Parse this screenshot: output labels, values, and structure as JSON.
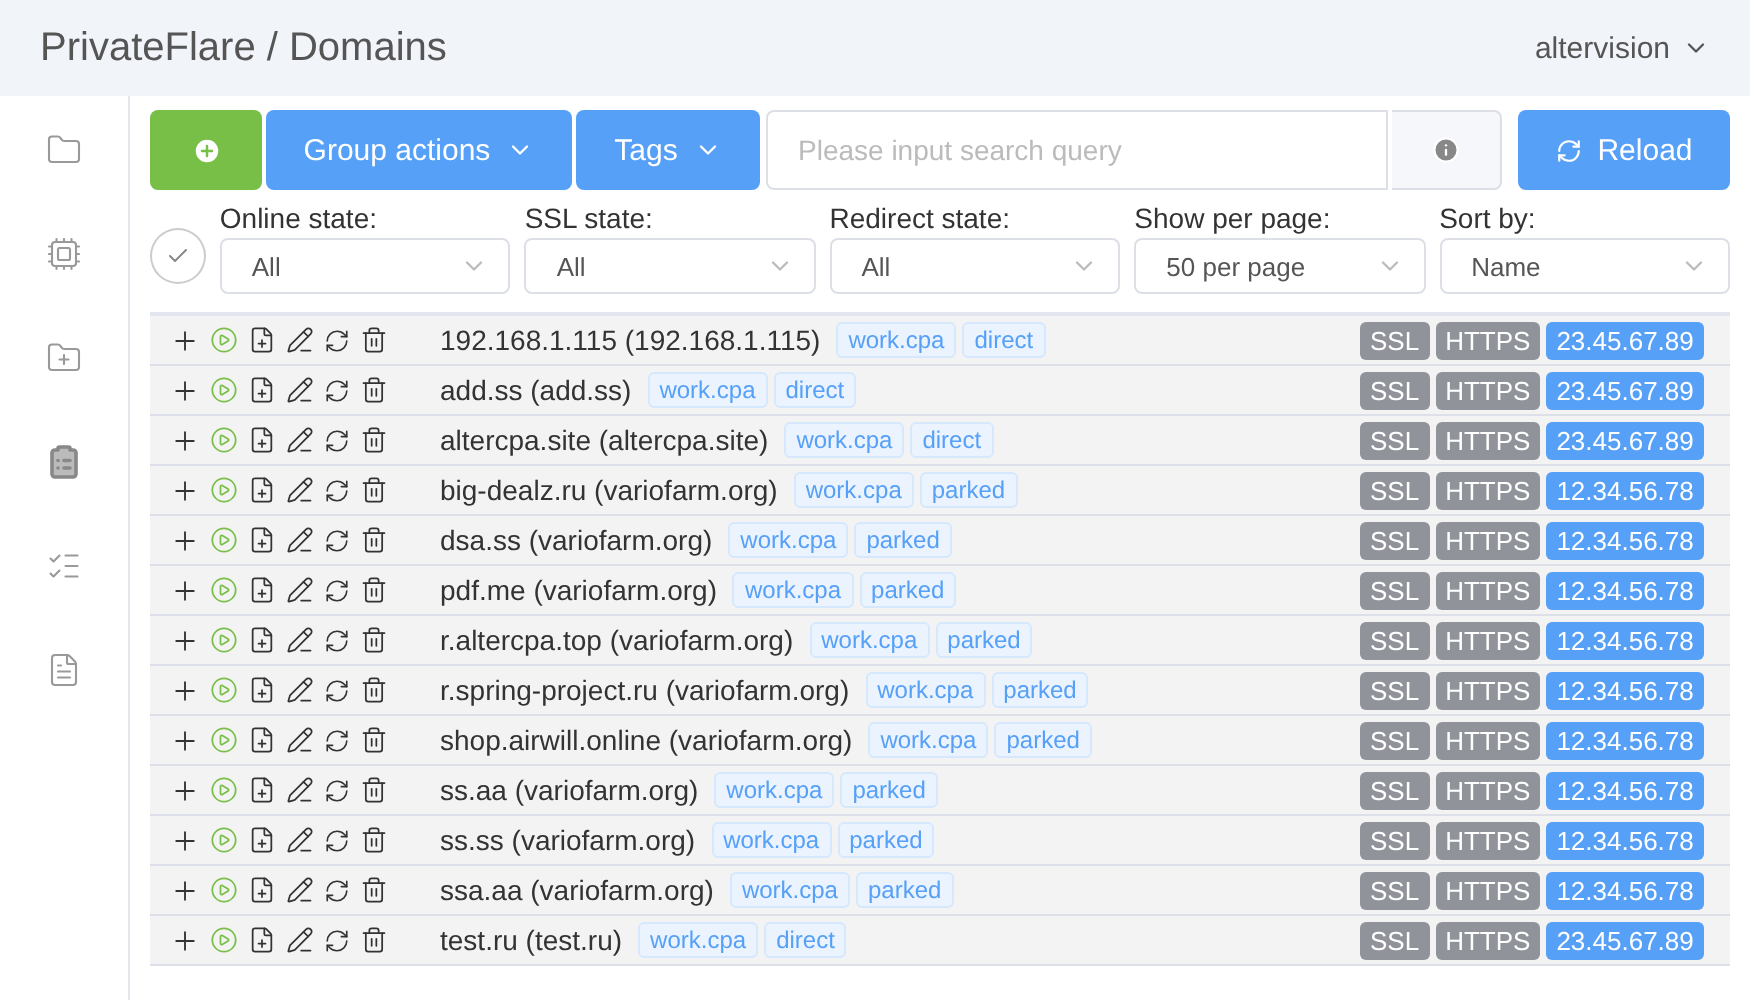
{
  "header": {
    "title": "PrivateFlare / Domains",
    "user": "altervision"
  },
  "sidebar": {
    "items": [
      {
        "selected": false
      },
      {
        "selected": false
      },
      {
        "selected": false
      },
      {
        "selected": true
      },
      {
        "selected": false
      },
      {
        "selected": false
      }
    ]
  },
  "select_all": {
    "checked": false
  },
  "toolbar": {
    "group_actions": "Group actions",
    "tags": "Tags",
    "search": {
      "placeholder": "Please input search query"
    },
    "reload": "Reload"
  },
  "filters": [
    {
      "label": "Online state:",
      "value": "All"
    },
    {
      "label": "SSL state:",
      "value": "All"
    },
    {
      "label": "Redirect state:",
      "value": "All"
    },
    {
      "label": "Show per page:",
      "value": "50 per page"
    },
    {
      "label": "Sort by:",
      "value": "Name"
    }
  ],
  "rows": [
    {
      "name": "192.168.1.115 (192.168.1.115)",
      "tags": [
        "work.cpa",
        "direct"
      ],
      "ssl": "SSL",
      "https": "HTTPS",
      "ip": "23.45.67.89"
    },
    {
      "name": "add.ss (add.ss)",
      "tags": [
        "work.cpa",
        "direct"
      ],
      "ssl": "SSL",
      "https": "HTTPS",
      "ip": "23.45.67.89"
    },
    {
      "name": "altercpa.site (altercpa.site)",
      "tags": [
        "work.cpa",
        "direct"
      ],
      "ssl": "SSL",
      "https": "HTTPS",
      "ip": "23.45.67.89"
    },
    {
      "name": "big-dealz.ru (variofarm.org)",
      "tags": [
        "work.cpa",
        "parked"
      ],
      "ssl": "SSL",
      "https": "HTTPS",
      "ip": "12.34.56.78"
    },
    {
      "name": "dsa.ss (variofarm.org)",
      "tags": [
        "work.cpa",
        "parked"
      ],
      "ssl": "SSL",
      "https": "HTTPS",
      "ip": "12.34.56.78"
    },
    {
      "name": "pdf.me (variofarm.org)",
      "tags": [
        "work.cpa",
        "parked"
      ],
      "ssl": "SSL",
      "https": "HTTPS",
      "ip": "12.34.56.78"
    },
    {
      "name": "r.altercpa.top (variofarm.org)",
      "tags": [
        "work.cpa",
        "parked"
      ],
      "ssl": "SSL",
      "https": "HTTPS",
      "ip": "12.34.56.78"
    },
    {
      "name": "r.spring-project.ru (variofarm.org)",
      "tags": [
        "work.cpa",
        "parked"
      ],
      "ssl": "SSL",
      "https": "HTTPS",
      "ip": "12.34.56.78"
    },
    {
      "name": "shop.airwill.online (variofarm.org)",
      "tags": [
        "work.cpa",
        "parked"
      ],
      "ssl": "SSL",
      "https": "HTTPS",
      "ip": "12.34.56.78"
    },
    {
      "name": "ss.aa (variofarm.org)",
      "tags": [
        "work.cpa",
        "parked"
      ],
      "ssl": "SSL",
      "https": "HTTPS",
      "ip": "12.34.56.78"
    },
    {
      "name": "ss.ss (variofarm.org)",
      "tags": [
        "work.cpa",
        "parked"
      ],
      "ssl": "SSL",
      "https": "HTTPS",
      "ip": "12.34.56.78"
    },
    {
      "name": "ssa.aa (variofarm.org)",
      "tags": [
        "work.cpa",
        "parked"
      ],
      "ssl": "SSL",
      "https": "HTTPS",
      "ip": "12.34.56.78"
    },
    {
      "name": "test.ru (test.ru)",
      "tags": [
        "work.cpa",
        "direct"
      ],
      "ssl": "SSL",
      "https": "HTTPS",
      "ip": "23.45.67.89"
    }
  ]
}
